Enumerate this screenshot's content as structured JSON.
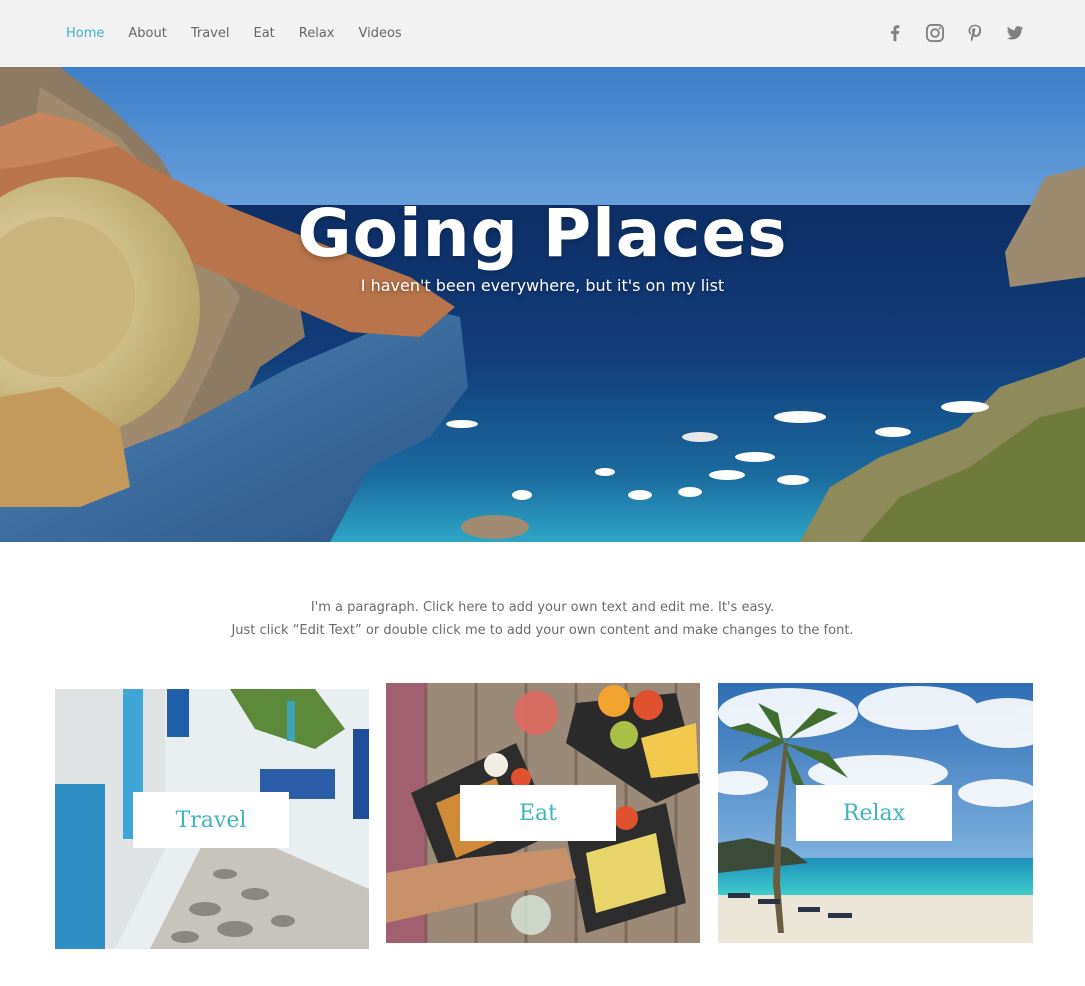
{
  "nav": {
    "items": [
      {
        "label": "Home",
        "active": true
      },
      {
        "label": "About",
        "active": false
      },
      {
        "label": "Travel",
        "active": false
      },
      {
        "label": "Eat",
        "active": false
      },
      {
        "label": "Relax",
        "active": false
      },
      {
        "label": "Videos",
        "active": false
      }
    ]
  },
  "social": {
    "icons": [
      "facebook-icon",
      "instagram-icon",
      "pinterest-icon",
      "twitter-icon"
    ],
    "color": "#808080"
  },
  "hero": {
    "title": "Going Places",
    "subtitle": "I haven't been everywhere, but it's on my list"
  },
  "intro": {
    "line1": "I'm a paragraph. Click here to add your own text and edit me. It's easy.",
    "line2": "Just click “Edit Text” or double click me to add your own content and make changes to the font."
  },
  "cards": {
    "travel": {
      "label": "Travel"
    },
    "eat": {
      "label": "Eat"
    },
    "relax": {
      "label": "Relax"
    }
  },
  "colors": {
    "accent": "#3fb5bf",
    "header_bg": "#f2f2f2",
    "nav_text": "#666666",
    "body_text": "#6b6b6b"
  }
}
